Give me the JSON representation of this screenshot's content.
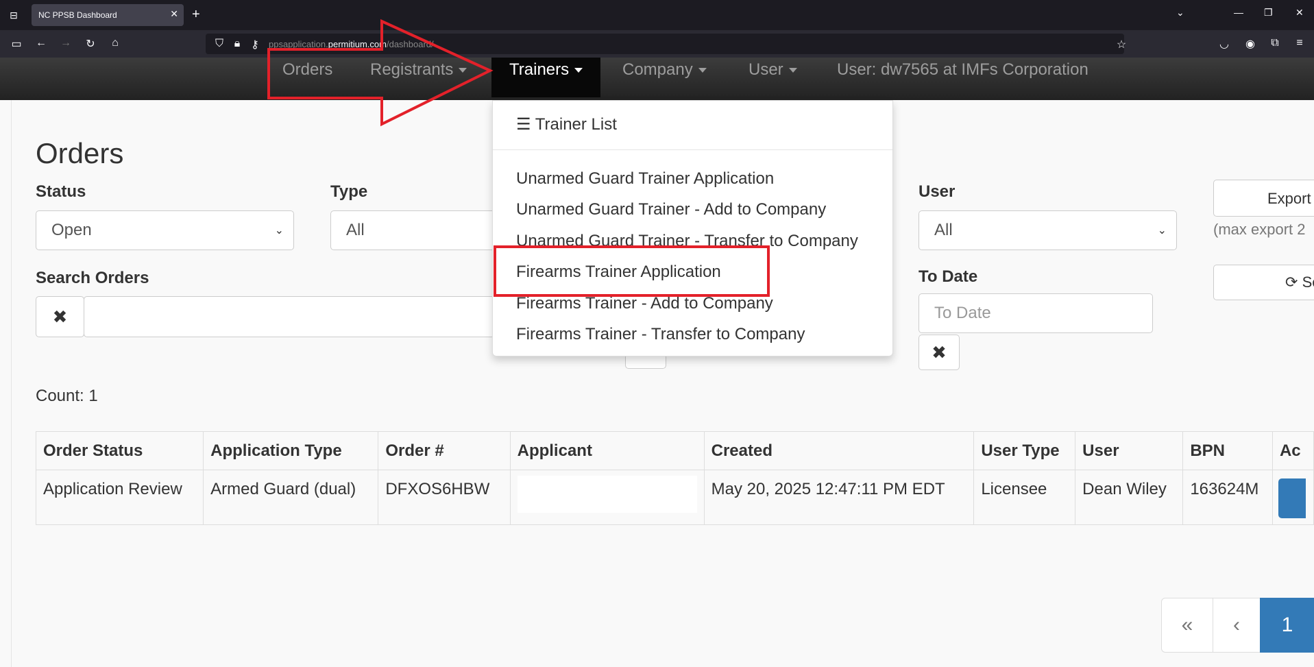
{
  "browser": {
    "tab_title": "NC PPSB Dashboard",
    "url_prefix": "ppsapplication.",
    "url_domain": "permitium.com",
    "url_path": "/dashboard/"
  },
  "app": {
    "brand": "NC PPSB Dashboard",
    "nav": {
      "orders": "Orders",
      "registrants": "Registrants",
      "trainers": "Trainers",
      "company": "Company",
      "user": "User",
      "user_info": "User: dw7565 at IMFs Corporation"
    }
  },
  "trainers_menu": {
    "items": [
      "Trainer List",
      "Unarmed Guard Trainer Application",
      "Unarmed Guard Trainer - Add to Company",
      "Unarmed Guard Trainer - Transfer to Company",
      "Firearms Trainer Application",
      "Firearms Trainer - Add to Company",
      "Firearms Trainer - Transfer to Company"
    ],
    "highlighted": "Firearms Trainer Application"
  },
  "page": {
    "title": "Orders",
    "filters": {
      "status_label": "Status",
      "status_value": "Open",
      "type_label": "Type",
      "type_value": "All",
      "user_label": "User",
      "user_value": "All",
      "search_label": "Search Orders",
      "to_date_label": "To Date",
      "to_date_placeholder": "To Date"
    },
    "export_label": "Export",
    "export_note": "(max export 2",
    "refresh_label": "Se",
    "count": "Count: 1"
  },
  "table": {
    "headers": [
      "Order Status",
      "Application Type",
      "Order #",
      "Applicant",
      "Created",
      "User Type",
      "User",
      "BPN",
      "Ac"
    ],
    "rows": [
      [
        "Application Review",
        "Armed Guard (dual)",
        "DFXOS6HBW",
        "",
        "May 20, 2025 12:47:11 PM EDT",
        "Licensee",
        "Dean Wiley",
        "163624M",
        ""
      ]
    ]
  },
  "pagination": {
    "first": "«",
    "prev": "‹",
    "current": "1"
  },
  "colors": {
    "annotation": "#e3212a",
    "primary": "#337ab7"
  }
}
